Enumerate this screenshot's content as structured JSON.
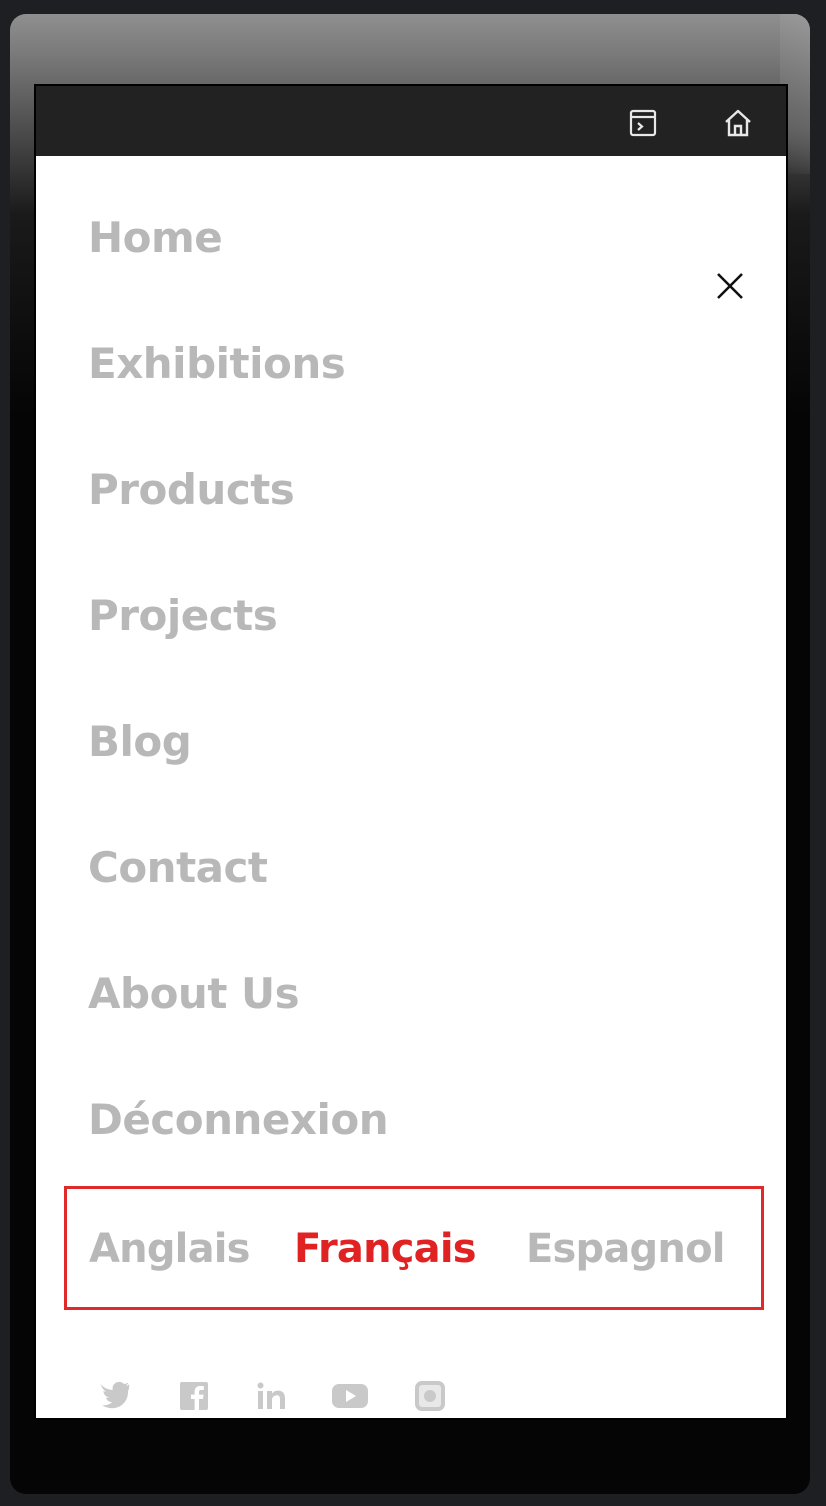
{
  "topbar": {
    "icons": [
      "terminal-panel-icon",
      "home-icon"
    ]
  },
  "menu": {
    "close_icon": "close-icon",
    "items": [
      {
        "label": "Home"
      },
      {
        "label": "Exhibitions"
      },
      {
        "label": "Products"
      },
      {
        "label": "Projects"
      },
      {
        "label": "Blog"
      },
      {
        "label": "Contact"
      },
      {
        "label": "About Us"
      },
      {
        "label": "Déconnexion"
      }
    ]
  },
  "languages": {
    "options": [
      {
        "label": "Anglais",
        "active": false
      },
      {
        "label": "Français",
        "active": true
      },
      {
        "label": "Espagnol",
        "active": false
      }
    ],
    "highlight_color": "#e02a2a",
    "inactive_color": "#b8b8b8"
  },
  "social": {
    "icons": [
      "twitter-icon",
      "facebook-icon",
      "linkedin-icon",
      "youtube-icon",
      "instagram-icon"
    ]
  }
}
